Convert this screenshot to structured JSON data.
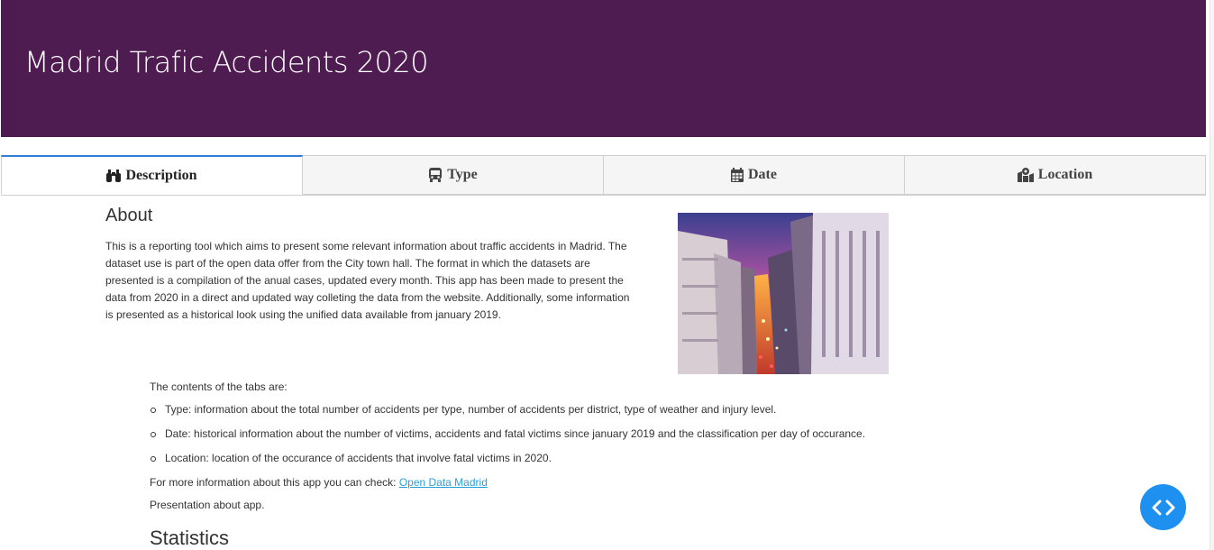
{
  "header": {
    "title": "Madrid Trafic Accidents 2020"
  },
  "tabs": [
    {
      "label": "Description",
      "icon": "binoculars-icon",
      "active": true
    },
    {
      "label": "Type",
      "icon": "bus-icon",
      "active": false
    },
    {
      "label": "Date",
      "icon": "calendar-icon",
      "active": false
    },
    {
      "label": "Location",
      "icon": "map-marked-icon",
      "active": false
    }
  ],
  "about": {
    "title": "About",
    "text": "This is a reporting tool which aims to present some relevant information about traffic accidents in Madrid. The dataset use is part of the open data offer from the City town hall. The format in which the datasets are presented is a compilation of the anual cases, updated every month. This app has been made to present the data from 2020 in a direct and updated way colleting the data from the website. Additionally, some information is presented as a historical look using the unified data available from january 2019."
  },
  "contents": {
    "intro": "The contents of the tabs are:",
    "items": [
      "Type: information about the total number of accidents per type, number of accidents per district, type of weather and injury level.",
      "Date: historical information about the number of victims, accidents and fatal victims since january 2019 and the classification per day of occurance.",
      "Location: location of the occurance of accidents that involve fatal victims in 2020."
    ]
  },
  "more_info": {
    "prefix": "For more information about this app you can check: ",
    "link_text": "Open Data Madrid"
  },
  "presentation": "Presentation about app.",
  "statistics_title": "Statistics",
  "colors": {
    "header_bg": "#4f1c52",
    "active_tab_border": "#2f7fd8",
    "link": "#2aa0d8",
    "fab": "#1e90f0"
  }
}
